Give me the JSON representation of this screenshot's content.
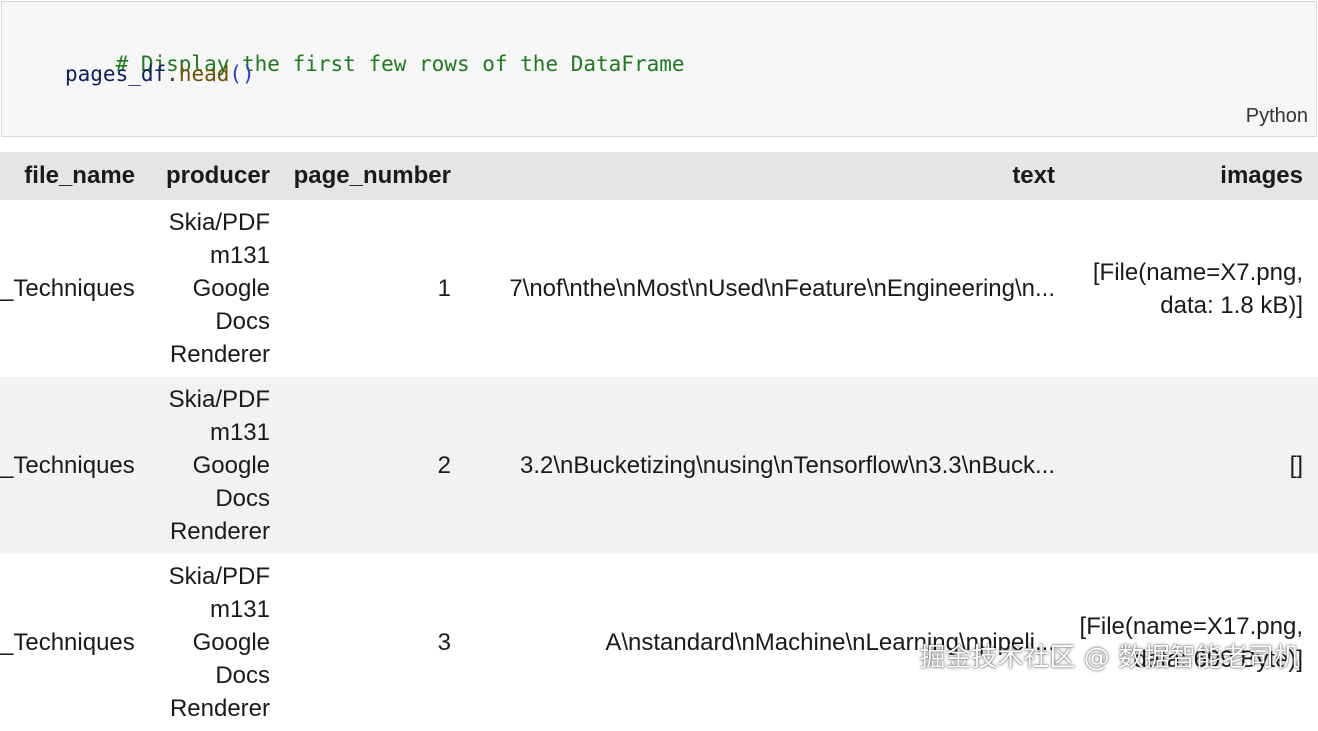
{
  "code_cell": {
    "comment": "# Display the first few rows of the DataFrame",
    "var": "pages_df",
    "dot": ".",
    "func": "head",
    "parens": "()",
    "language": "Python"
  },
  "table": {
    "headers": [
      "file_name",
      "producer",
      "page_number",
      "text",
      "images"
    ],
    "rows": [
      {
        "file_name": "_Techniques",
        "producer": "Skia/PDF m131 Google Docs Renderer",
        "page_number": "1",
        "text": "7\\nof\\nthe\\nMost\\nUsed\\nFeature\\nEngineering\\n...",
        "images": "[File(name=X7.png, data: 1.8 kB)]"
      },
      {
        "file_name": "_Techniques",
        "producer": "Skia/PDF m131 Google Docs Renderer",
        "page_number": "2",
        "text": "3.2\\nBucketizing\\nusing\\nTensorflow\\n3.3\\nBuck...",
        "images": "[]"
      },
      {
        "file_name": "_Techniques",
        "producer": "Skia/PDF m131 Google Docs Renderer",
        "page_number": "3",
        "text": "A\\nstandard\\nMachine\\nLearning\\npipeli...",
        "images": "[File(name=X17.png, data: 699 Byte)]"
      }
    ]
  },
  "watermark": "掘金技术社区 @ 数据智能老司机"
}
